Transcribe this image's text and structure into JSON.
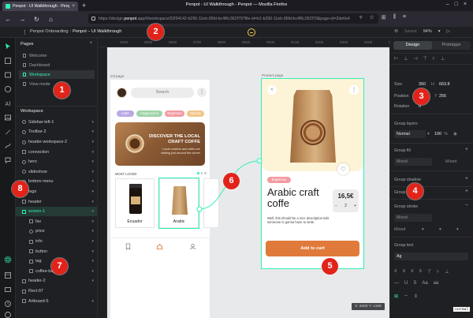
{
  "browser": {
    "tab_title": "Penpot - UI Walkthrough - Penpot",
    "window_title": "Penpot - UI Walkthrough - Penpot — Mozilla Firefox",
    "new_tab": "+",
    "url_prefix": "https://design.",
    "url_host": "penpot",
    "url_rest": ".app/#/workspace/32f34142-b296-11eb-95fd-bc4f6c362f79?file-id=b1-b296-11eb-95fd-bc4f6c362f79&page-id=2de6e4"
  },
  "header": {
    "menu": "⋮",
    "project": "Penpot Onboarding",
    "separator": "/",
    "file": "Penpot – UI Walkthrough",
    "saved": "Saved",
    "zoom": "94%"
  },
  "pages": {
    "title": "Pages",
    "add": "+",
    "items": [
      {
        "label": "Welcome"
      },
      {
        "label": "Dashboard"
      },
      {
        "label": "Workspace",
        "active": true
      },
      {
        "label": "View mode"
      }
    ]
  },
  "layers": {
    "title": "Workspace",
    "items": [
      {
        "label": "Sidebar-left-1",
        "kind": "comp",
        "indent": 1,
        "chev": true
      },
      {
        "label": "Toolbar-2",
        "kind": "comp",
        "indent": 1,
        "chev": true
      },
      {
        "label": "header-workspace-2",
        "kind": "comp",
        "indent": 1,
        "chev": true
      },
      {
        "label": "connection",
        "kind": "box",
        "indent": 1,
        "chev": true
      },
      {
        "label": "hero",
        "kind": "comp",
        "indent": 1,
        "chev": true
      },
      {
        "label": "slideshow",
        "kind": "comp",
        "indent": 1,
        "chev": true
      },
      {
        "label": "bottom menu",
        "kind": "comp",
        "indent": 1,
        "chev": true
      },
      {
        "label": "tags",
        "kind": "comp",
        "indent": 1,
        "chev": true
      },
      {
        "label": "header",
        "kind": "box",
        "indent": 1,
        "chev": true
      },
      {
        "label": "screen-1",
        "kind": "board",
        "indent": 1,
        "chev": true,
        "selected": true
      },
      {
        "label": "fav",
        "kind": "box",
        "indent": 2,
        "chev": true
      },
      {
        "label": "price",
        "kind": "comp",
        "indent": 2,
        "chev": true
      },
      {
        "label": "info",
        "kind": "box",
        "indent": 2,
        "chev": true
      },
      {
        "label": "button",
        "kind": "box",
        "indent": 2,
        "chev": true
      },
      {
        "label": "tag",
        "kind": "box",
        "indent": 2,
        "chev": true
      },
      {
        "label": "coffee-bag-2",
        "kind": "box",
        "indent": 2,
        "chev": true
      },
      {
        "label": "header-2",
        "kind": "box",
        "indent": 1,
        "chev": true
      },
      {
        "label": "Rect-97",
        "kind": "box",
        "indent": 1,
        "chev": false
      },
      {
        "label": "Artboard-5",
        "kind": "board",
        "indent": 1,
        "chev": true
      }
    ]
  },
  "ruler": {
    "ticks": [
      "8400",
      "8500",
      "8600",
      "8700",
      "8800",
      "8900",
      "9000",
      "9100",
      "9200",
      "9300",
      "9400",
      "9500"
    ]
  },
  "canvas": {
    "board1_label": "init page",
    "board2_label": "Product page",
    "search": "Search",
    "kebab": "⋮",
    "chips": [
      {
        "label": "Latte",
        "color": "#b9a9e3"
      },
      {
        "label": "Cappuccino",
        "color": "#9fd3a8"
      },
      {
        "label": "Espresso",
        "color": "#f29ba2"
      },
      {
        "label": "Mocha",
        "color": "#f2c48a"
      }
    ],
    "banner_title": "DISCOVER THE LOCAL CRAFT COFFE",
    "banner_sub": "Local roasters and cafés are waiting just around the corner",
    "most_loved": "MOST LOVED",
    "cards": [
      {
        "label": "Ecuador"
      },
      {
        "label": "Arabic"
      }
    ],
    "tag": "Espresso",
    "product_title": "Arabic craft coffe",
    "price": "16,5€",
    "qty_minus": "−",
    "qty_value": "2",
    "qty_plus": "+",
    "description": "Well, this should be a nice description taht someone is gonna have to write.",
    "add_to_cart": "Add to cart",
    "coords": "X: 8403  Y: 1106"
  },
  "design": {
    "tab_design": "Design",
    "tab_prototype": "Prototype",
    "size_label": "Size",
    "width": "360",
    "height": "663.8",
    "position_label": "Position",
    "x": "0",
    "y": "256",
    "rotation_label": "Rotation",
    "rotation": "0",
    "group_layers": "Group layers",
    "blend": "Normal",
    "opacity": "100",
    "group_fill": "Group fill",
    "fill_value": "Mixed",
    "fill_right": "Mixed",
    "group_shadow": "Group shadow",
    "group_blur": "Group blur",
    "group_stroke": "Group stroke",
    "stroke_value": "Mixed",
    "stroke_mixed": "Mixed",
    "group_text": "Group text",
    "font_value": "Ag",
    "plus": "+",
    "minus": "−"
  },
  "markers": [
    "1",
    "2",
    "3",
    "4",
    "5",
    "6",
    "7",
    "8"
  ],
  "badge": "normal"
}
